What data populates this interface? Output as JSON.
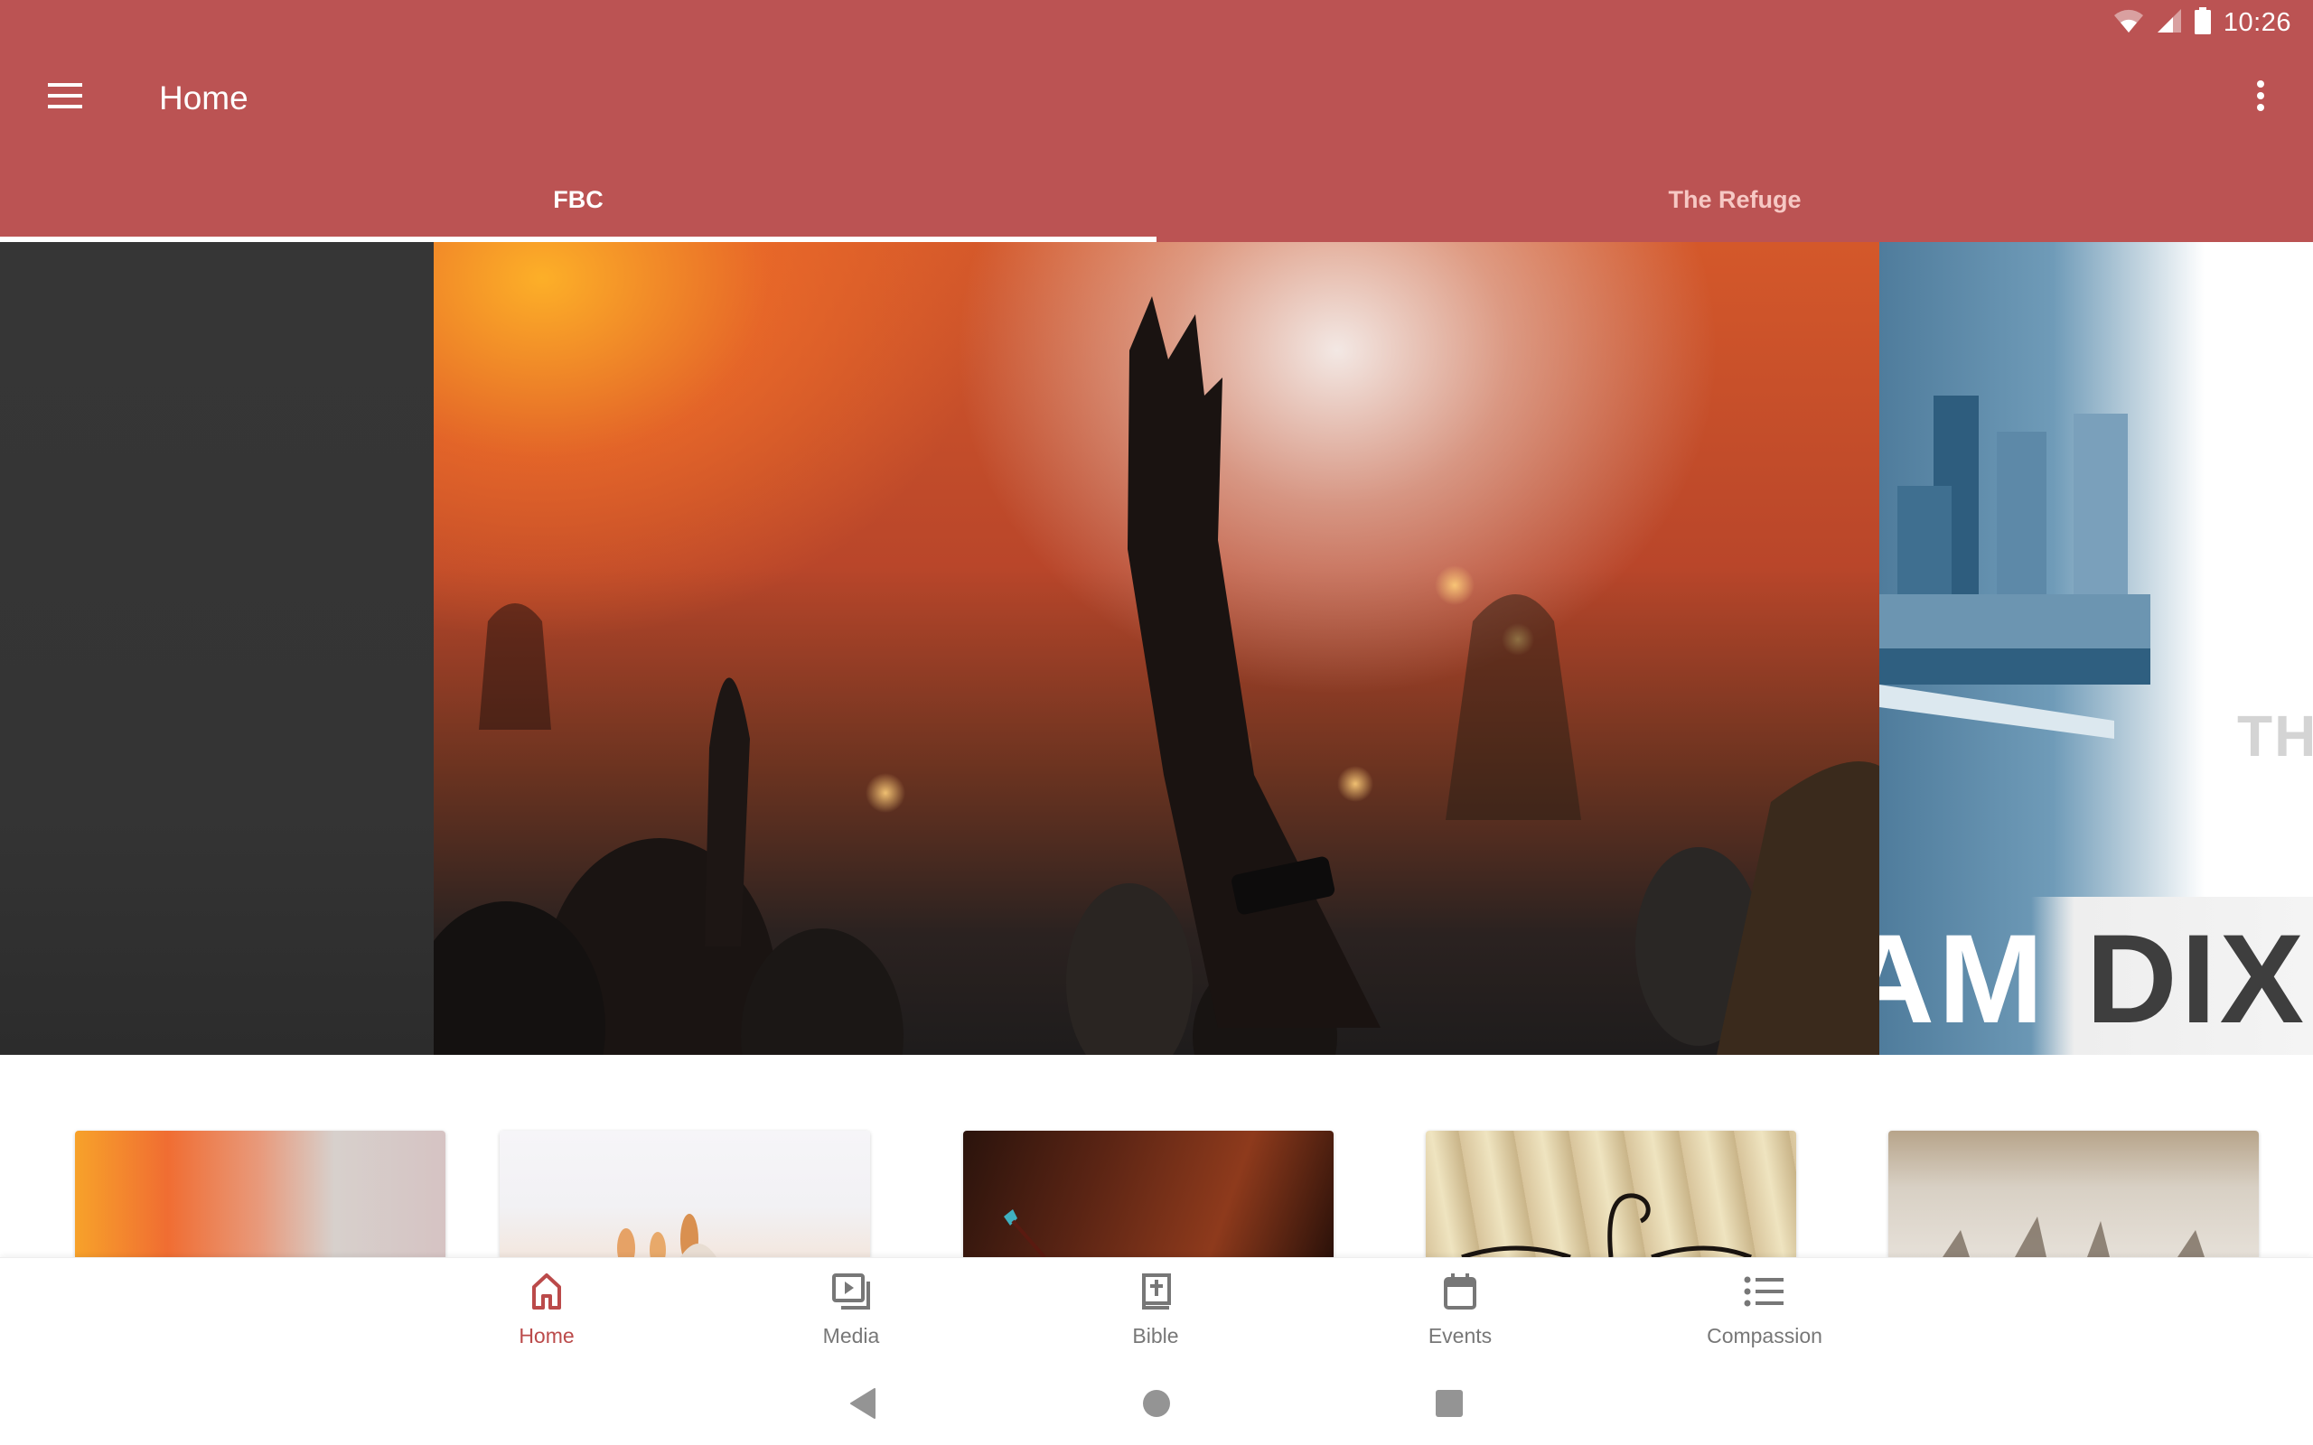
{
  "status_bar": {
    "time": "10:26",
    "icons": [
      "wifi-icon",
      "cellular-signal-icon",
      "battery-icon"
    ]
  },
  "app_bar": {
    "title": "Home",
    "menu_icon": "hamburger-menu-icon",
    "overflow_icon": "more-vert-icon"
  },
  "tabs": [
    {
      "label": "FBC",
      "selected": true
    },
    {
      "label": "The Refuge",
      "selected": false
    }
  ],
  "carousel": {
    "slide_count": 4,
    "active_index": 0,
    "right_slide_text": {
      "top": "TH",
      "title_part_1": "AM",
      "title_part_2": "DIXI"
    }
  },
  "cards": [
    {
      "name": "card-1"
    },
    {
      "name": "card-2"
    },
    {
      "name": "card-3"
    },
    {
      "name": "card-4"
    },
    {
      "name": "card-5"
    }
  ],
  "bottom_nav": {
    "items": [
      {
        "label": "Home",
        "icon": "home-icon",
        "active": true
      },
      {
        "label": "Media",
        "icon": "media-library-icon",
        "active": false
      },
      {
        "label": "Bible",
        "icon": "bible-icon",
        "active": false
      },
      {
        "label": "Events",
        "icon": "calendar-icon",
        "active": false
      },
      {
        "label": "Compassion",
        "icon": "list-icon",
        "active": false
      }
    ]
  },
  "system_nav": {
    "buttons": [
      "back",
      "home",
      "recents"
    ]
  },
  "colors": {
    "primary": "#bb5353",
    "active_nav": "#bb4a4a",
    "inactive_nav": "#777777",
    "tab_inactive_text": "#f6c8c4"
  }
}
